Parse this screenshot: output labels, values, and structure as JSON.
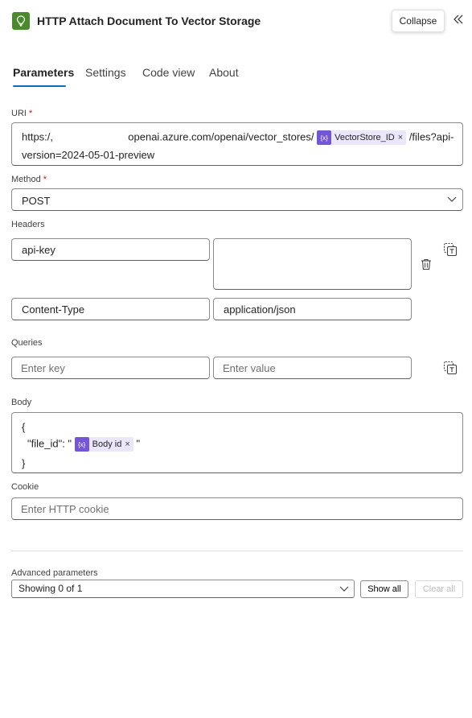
{
  "header": {
    "title": "HTTP Attach Document To Vector Storage",
    "app_icon": "lightbulb-icon",
    "collapse_label": "Collapse",
    "collapse_icon": "double-chevron-left-icon"
  },
  "tabs": [
    {
      "label": "Parameters",
      "active": true
    },
    {
      "label": "Settings",
      "active": false
    },
    {
      "label": "Code view",
      "active": false
    },
    {
      "label": "About",
      "active": false
    }
  ],
  "uri": {
    "label": "URI",
    "required_mark": "*",
    "prefix": "https:/,",
    "middle": "openai.azure.com/openai/vector_stores/",
    "token": "VectorStore_ID",
    "suffix": "/files?api-",
    "line2": "version=2024-05-01-preview"
  },
  "method": {
    "label": "Method",
    "required_mark": "*",
    "value": "POST"
  },
  "headers": {
    "label": "Headers",
    "rows": [
      {
        "key": "api-key",
        "value": ""
      },
      {
        "key": "Content-Type",
        "value": "application/json"
      }
    ]
  },
  "queries": {
    "label": "Queries",
    "key_placeholder": "Enter key",
    "value_placeholder": "Enter value"
  },
  "body": {
    "label": "Body",
    "line1": "{",
    "line2_prefix": "\"file_id\": \"",
    "token": "Body id",
    "line2_suffix": "\"",
    "line3": "}"
  },
  "cookie": {
    "label": "Cookie",
    "placeholder": "Enter HTTP cookie"
  },
  "advanced": {
    "label": "Advanced parameters",
    "select_value": "Showing 0 of 1",
    "show_all_label": "Show all",
    "clear_all_label": "Clear all"
  },
  "token_symbol": "{x}",
  "token_remove": "×",
  "colors": {
    "accent": "#0f6cbd",
    "token_bg": "#ece6fb",
    "token_icon": "#7356d8",
    "app_icon_bg": "#4a8a2c",
    "required": "#c50f1f"
  }
}
